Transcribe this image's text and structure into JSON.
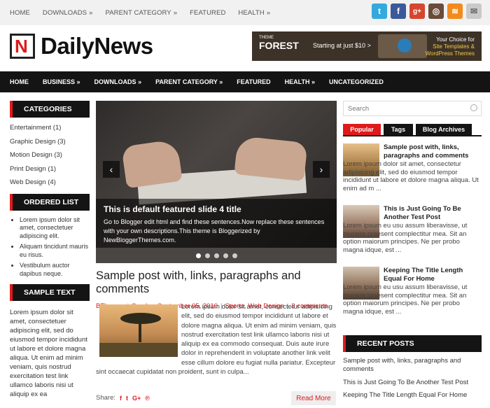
{
  "topnav": {
    "items": [
      "HOME",
      "DOWNLOADS",
      "PARENT CATEGORY",
      "FEATURED",
      "HEALTH"
    ],
    "arrows": [
      "",
      "»",
      "»",
      "",
      "»"
    ]
  },
  "social": [
    {
      "icon": "twitter-icon",
      "glyph": "t",
      "color": "#34a9de"
    },
    {
      "icon": "facebook-icon",
      "glyph": "f",
      "color": "#3b5a9a"
    },
    {
      "icon": "googleplus-icon",
      "glyph": "g+",
      "color": "#d6452f"
    },
    {
      "icon": "instagram-icon",
      "glyph": "◎",
      "color": "#6b4b3a"
    },
    {
      "icon": "rss-icon",
      "glyph": "≋",
      "color": "#f28a1e"
    },
    {
      "icon": "email-icon",
      "glyph": "✉",
      "color": "#c9c9c9"
    }
  ],
  "logo": {
    "text": "DailyNews",
    "mark": "N"
  },
  "banner": {
    "brand_small": "THEME",
    "brand": "FOREST",
    "offer": "Starting at just $10",
    "arrow": ">",
    "line1": "Your Choice for",
    "line2": "Site Templates &",
    "line3": "WordPress Themes"
  },
  "mainnav": {
    "items": [
      "HOME",
      "BUSINESS",
      "DOWNLOADS",
      "PARENT CATEGORY",
      "FEATURED",
      "HEALTH",
      "UNCATEGORIZED"
    ],
    "arrows": [
      "",
      "»",
      "»",
      "»",
      "",
      "»",
      ""
    ]
  },
  "left": {
    "categories_title": "CATEGORIES",
    "categories": [
      "Entertainment (1)",
      "Graphic Design (3)",
      "Motion Design (3)",
      "Print Design (1)",
      "Web Design (4)"
    ],
    "ordered_title": "ORDERED LIST",
    "ordered": [
      "Lorem ipsum dolor sit amet, consectetuer adipiscing elit.",
      "Aliquam tincidunt mauris eu risus.",
      "Vestibulum auctor dapibus neque."
    ],
    "sample_title": "SAMPLE TEXT",
    "sample_text": "Lorem ipsum dolor sit amet, consectetuer adipiscing elit, sed do eiusmod tempor incididunt ut labore et dolore magna aliqua. Ut enim ad minim veniam, quis nostrud exercitation test link ullamco laboris nisi ut aliquip ex ea"
  },
  "slider": {
    "title": "This is default featured slide 4 title",
    "desc": "Go to Blogger edit html and find these sentences.Now replace these sentences with your own descriptions.This theme is Bloggerized by NewBloggerThemes.com.",
    "prev": "‹",
    "next": "›",
    "dots": 5,
    "active_dot": 1
  },
  "post": {
    "title": "Sample post with, links, paragraphs and comments",
    "author": "BThemes",
    "date": "Sunday, September 05, 2010",
    "categories": "Sports, Web Design",
    "comments": "2 comments",
    "body": "Lorem ipsum dolor sit amet, consectetur adipisicing elit, sed do eiusmod tempor incididunt ut labore et dolore magna aliqua. Ut enim ad minim veniam, quis nostrud exercitation test link ullamco laboris nisi ut aliquip ex ea commodo consequat. Duis aute irure dolor in reprehenderit in voluptate another link velit esse cillum dolore eu fugiat nulla pariatur. Excepteur sint occaecat cupidatat non proident, sunt in culpa...",
    "share_label": "Share:",
    "read_more": "Read More"
  },
  "right": {
    "search_placeholder": "Search",
    "tabs": [
      "Popular",
      "Tags",
      "Blog Archives"
    ],
    "posts": [
      {
        "title": "Sample post with, links, paragraphs and comments",
        "excerpt": "Lorem ipsum dolor sit amet, consectetur adipisicing elit, sed do eiusmod tempor incididunt ut labore et dolore magna aliqua. Ut enim ad m ..."
      },
      {
        "title": "This is Just Going To Be Another Test Post",
        "excerpt": "Lorem ipsum eu usu assum liberavisse, ut munere praesent complectitur mea. Sit an option maiorum principes. Ne per probo magna idque, est ..."
      },
      {
        "title": "Keeping The Title Length Equal For Home",
        "excerpt": "Lorem ipsum eu usu assum liberavisse, ut munere praesent complectitur mea. Sit an option maiorum principes. Ne per probo magna idque, est ..."
      }
    ],
    "recent_title": "RECENT POSTS",
    "recent": [
      "Sample post with, links, paragraphs and comments",
      "This is Just Going To Be Another Test Post",
      "Keeping The Title Length Equal For Home"
    ]
  }
}
